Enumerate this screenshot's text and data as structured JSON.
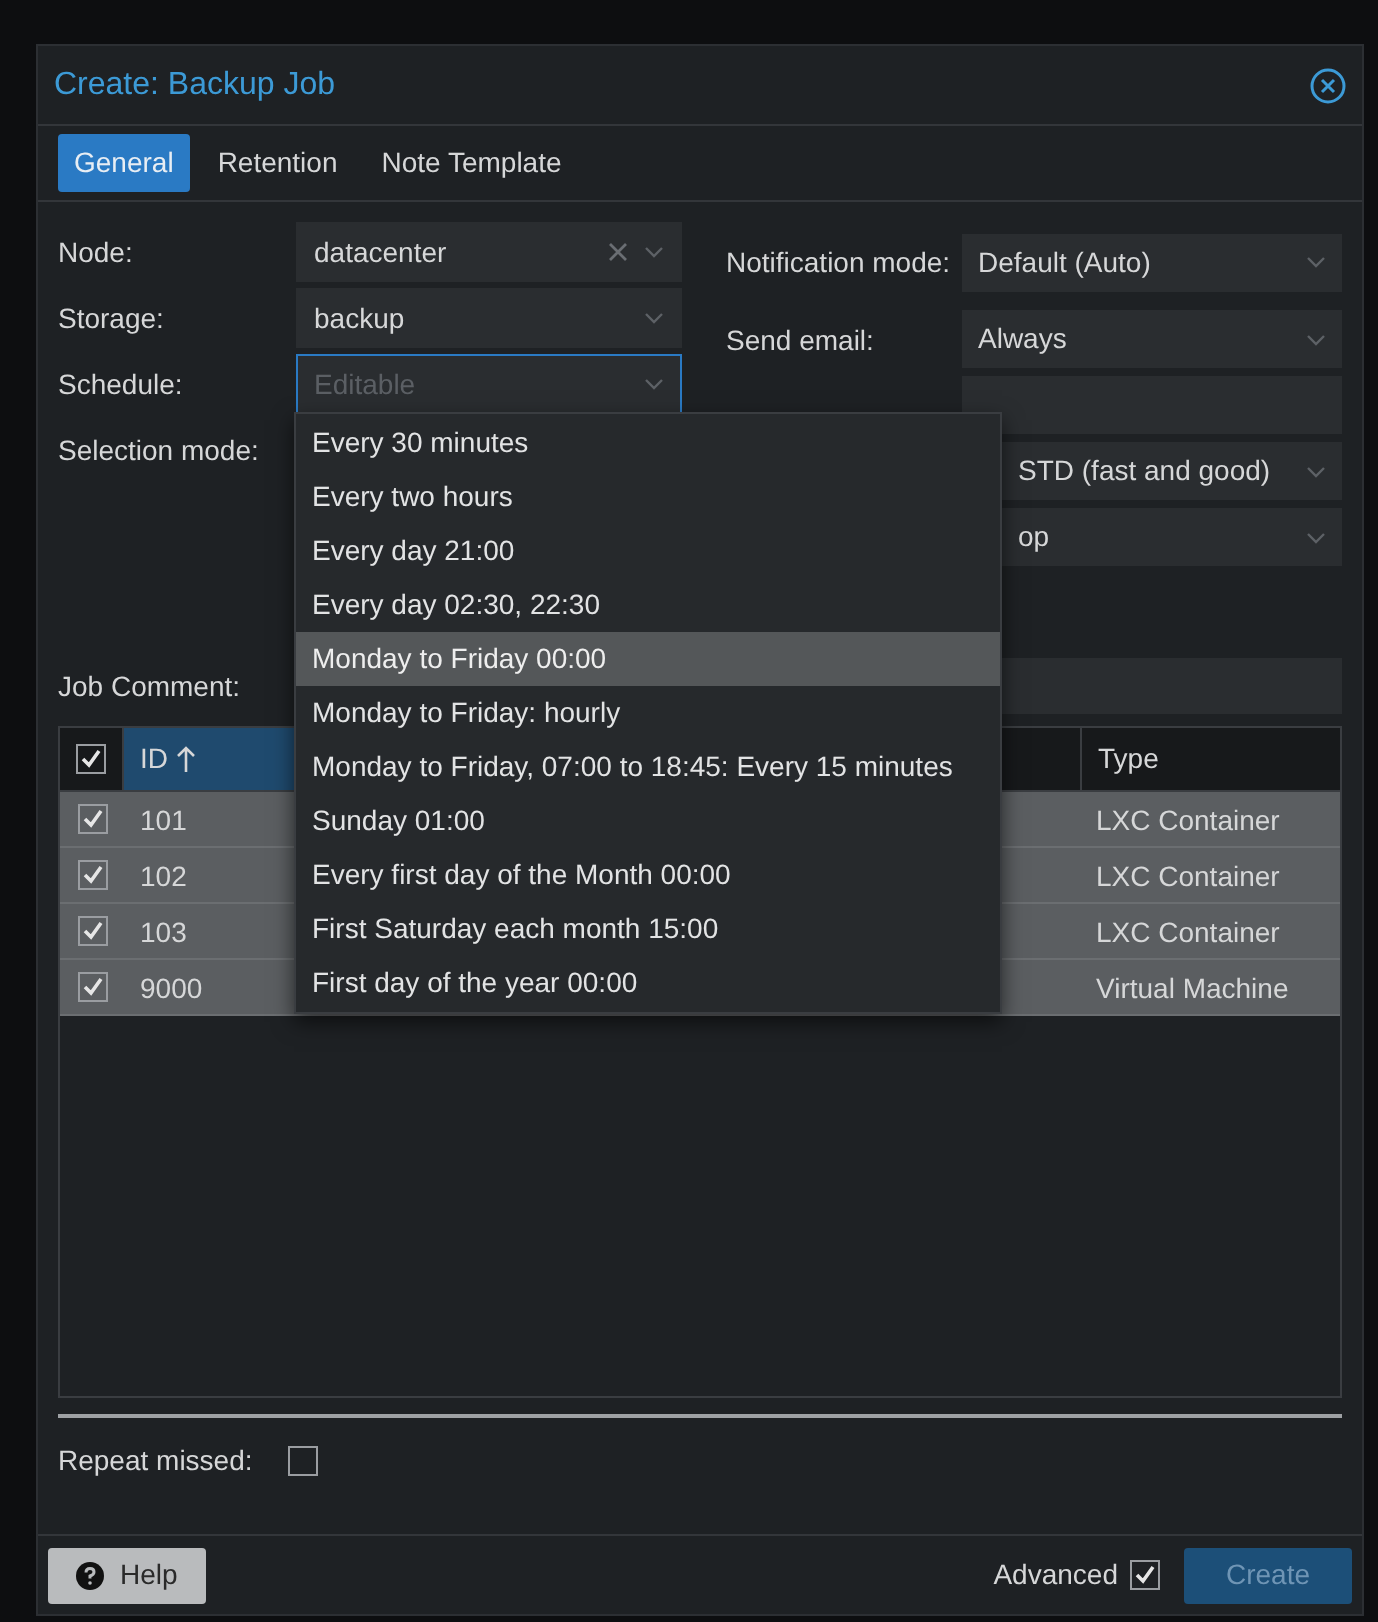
{
  "window": {
    "title": "Create: Backup Job"
  },
  "tabs": [
    {
      "label": "General",
      "selected": true
    },
    {
      "label": "Retention",
      "selected": false
    },
    {
      "label": "Note Template",
      "selected": false
    }
  ],
  "left_fields": [
    {
      "label": "Node:",
      "value": "datacenter",
      "clearable": true,
      "focused": false
    },
    {
      "label": "Storage:",
      "value": "backup",
      "clearable": false,
      "focused": false
    },
    {
      "label": "Schedule:",
      "placeholder": "Editable",
      "clearable": false,
      "focused": true
    },
    {
      "label": "Selection mode:"
    }
  ],
  "right_fields": [
    {
      "kind": "select",
      "label": "Notification mode:",
      "value": "Default (Auto)"
    },
    {
      "kind": "select",
      "label": "Send email:",
      "value": "Always"
    },
    {
      "kind": "input"
    },
    {
      "kind": "select",
      "value": "STD (fast and good)"
    },
    {
      "kind": "select",
      "value": "op"
    }
  ],
  "job_comment": {
    "label": "Job Comment:"
  },
  "table": {
    "columns": [
      {
        "label": "ID",
        "sorted": true
      },
      {
        "label": "Type",
        "sorted": false
      }
    ],
    "header_checked": true,
    "rows": [
      {
        "checked": true,
        "id": "101",
        "type": "LXC Container"
      },
      {
        "checked": true,
        "id": "102",
        "type": "LXC Container"
      },
      {
        "checked": true,
        "id": "103",
        "type": "LXC Container"
      },
      {
        "checked": true,
        "id": "9000",
        "type": "Virtual Machine"
      }
    ]
  },
  "schedule_menu": [
    {
      "label": "Every 30 minutes",
      "selected": false
    },
    {
      "label": "Every two hours",
      "selected": false
    },
    {
      "label": "Every day 21:00",
      "selected": false
    },
    {
      "label": "Every day 02:30, 22:30",
      "selected": false
    },
    {
      "label": "Monday to Friday 00:00",
      "selected": true
    },
    {
      "label": "Monday to Friday: hourly",
      "selected": false
    },
    {
      "label": "Monday to Friday, 07:00 to 18:45: Every 15 minutes",
      "selected": false
    },
    {
      "label": "Sunday 01:00",
      "selected": false
    },
    {
      "label": "Every first day of the Month 00:00",
      "selected": false
    },
    {
      "label": "First Saturday each month 15:00",
      "selected": false
    },
    {
      "label": "First day of the year 00:00",
      "selected": false
    }
  ],
  "repeat_missed": {
    "label": "Repeat missed:",
    "checked": false
  },
  "footer": {
    "help": "Help",
    "advanced": {
      "label": "Advanced",
      "checked": true
    },
    "create": {
      "label": "Create",
      "disabled": true
    }
  }
}
